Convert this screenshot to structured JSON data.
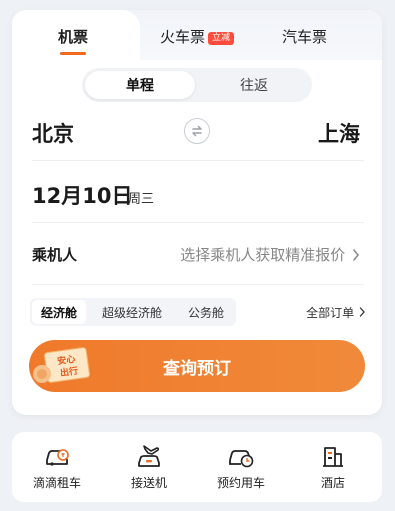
{
  "tabs": [
    {
      "label": "机票",
      "active": true
    },
    {
      "label": "火车票",
      "badge": "立减",
      "active": false
    },
    {
      "label": "汽车票",
      "active": false
    }
  ],
  "trip_type": {
    "options": [
      "单程",
      "往返"
    ],
    "selected": "单程"
  },
  "route": {
    "from": "北京",
    "to": "上海"
  },
  "date": {
    "main": "12月10日",
    "weekday": "周三"
  },
  "passenger": {
    "label": "乘机人",
    "hint": "选择乘机人获取精准报价"
  },
  "cabins": {
    "options": [
      "经济舱",
      "超级经济舱",
      "公务舱"
    ],
    "selected": "经济舱"
  },
  "all_orders": "全部订单",
  "search_button": "查询预订",
  "stamp": {
    "line1": "安心",
    "line2": "出行"
  },
  "services": [
    {
      "label": "滴滴租车",
      "icon": "car-rental-icon"
    },
    {
      "label": "接送机",
      "icon": "airport-transfer-icon"
    },
    {
      "label": "预约用车",
      "icon": "scheduled-car-icon"
    },
    {
      "label": "酒店",
      "icon": "hotel-icon"
    }
  ],
  "colors": {
    "accent": "#f26a1f",
    "button": "#f0792b",
    "badge": "#ff4d3d",
    "background": "#eef1f5"
  }
}
